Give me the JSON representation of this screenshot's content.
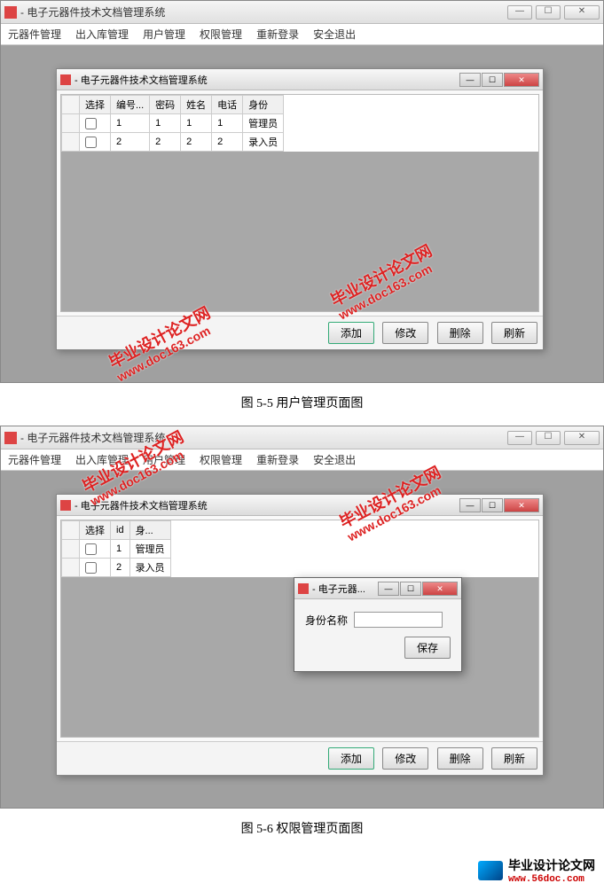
{
  "app_title": "- 电子元器件技术文档管理系统",
  "menu": [
    "元器件管理",
    "出入库管理",
    "用户管理",
    "权限管理",
    "重新登录",
    "安全退出"
  ],
  "win_controls": {
    "min": "—",
    "max": "☐",
    "close": "✕"
  },
  "fig1": {
    "child_title": "- 电子元器件技术文档管理系统",
    "columns": [
      "选择",
      "编号...",
      "密码",
      "姓名",
      "电话",
      "身份"
    ],
    "rows": [
      {
        "c0": "",
        "c1": "1",
        "c2": "1",
        "c3": "1",
        "c4": "1",
        "c5": "管理员"
      },
      {
        "c0": "",
        "c1": "2",
        "c2": "2",
        "c3": "2",
        "c4": "2",
        "c5": "录入员"
      }
    ],
    "buttons": [
      "添加",
      "修改",
      "删除",
      "刷新"
    ],
    "caption": "图 5-5 用户管理页面图"
  },
  "fig2": {
    "child_title": "- 电子元器件技术文档管理系统",
    "columns": [
      "选择",
      "id",
      "身..."
    ],
    "rows": [
      {
        "c0": "",
        "c1": "1",
        "c2": "管理员"
      },
      {
        "c0": "",
        "c1": "2",
        "c2": "录入员"
      }
    ],
    "dialog": {
      "title": "- 电子元器...",
      "label": "身份名称",
      "save": "保存"
    },
    "buttons": [
      "添加",
      "修改",
      "删除",
      "刷新"
    ],
    "caption": "图 5-6 权限管理页面图"
  },
  "watermark": {
    "cn": "毕业设计论文网",
    "url": "www.doc163.com"
  },
  "footer": {
    "text": "毕业设计论文网",
    "url": "www.56doc.com"
  }
}
